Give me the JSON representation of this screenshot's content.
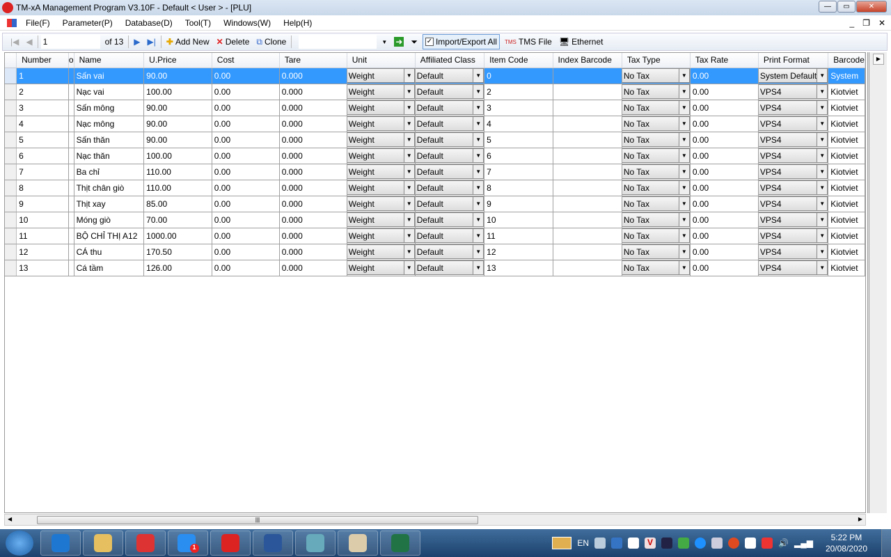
{
  "window": {
    "title": "TM-xA Management Program V3.10F - Default < User >  - [PLU]"
  },
  "menu": [
    "File(F)",
    "Parameter(P)",
    "Database(D)",
    "Tool(T)",
    "Windows(W)",
    "Help(H)"
  ],
  "toolbar": {
    "position": "1",
    "of": "of 13",
    "add_new": "Add New",
    "delete": "Delete",
    "clone": "Clone",
    "import_export": "Import/Export All",
    "tms_file": "TMS File",
    "ethernet": "Ethernet"
  },
  "columns": [
    "Number",
    "o",
    "Name",
    "U.Price",
    "Cost",
    "Tare",
    "Unit",
    "Affiliated Class",
    "Item Code",
    "Index Barcode",
    "Tax Type",
    "Tax Rate",
    "Print Format",
    "Barcode"
  ],
  "rows": [
    [
      "1",
      "Sấn vai",
      "90.00",
      "0.00",
      "0.000",
      "Weight",
      "Default",
      "0",
      "",
      "No Tax",
      "0.00",
      "System Default",
      "System"
    ],
    [
      "2",
      "Nạc vai",
      "100.00",
      "0.00",
      "0.000",
      "Weight",
      "Default",
      "2",
      "",
      "No Tax",
      "0.00",
      "VPS4",
      "Kiotviet"
    ],
    [
      "3",
      "Sấn mông",
      "90.00",
      "0.00",
      "0.000",
      "Weight",
      "Default",
      "3",
      "",
      "No Tax",
      "0.00",
      "VPS4",
      "Kiotviet"
    ],
    [
      "4",
      "Nạc mông",
      "90.00",
      "0.00",
      "0.000",
      "Weight",
      "Default",
      "4",
      "",
      "No Tax",
      "0.00",
      "VPS4",
      "Kiotviet"
    ],
    [
      "5",
      "Sấn thăn",
      "90.00",
      "0.00",
      "0.000",
      "Weight",
      "Default",
      "5",
      "",
      "No Tax",
      "0.00",
      "VPS4",
      "Kiotviet"
    ],
    [
      "6",
      "Nạc thăn",
      "100.00",
      "0.00",
      "0.000",
      "Weight",
      "Default",
      "6",
      "",
      "No Tax",
      "0.00",
      "VPS4",
      "Kiotviet"
    ],
    [
      "7",
      "Ba chỉ",
      "110.00",
      "0.00",
      "0.000",
      "Weight",
      "Default",
      "7",
      "",
      "No Tax",
      "0.00",
      "VPS4",
      "Kiotviet"
    ],
    [
      "8",
      "Thịt chân giò",
      "110.00",
      "0.00",
      "0.000",
      "Weight",
      "Default",
      "8",
      "",
      "No Tax",
      "0.00",
      "VPS4",
      "Kiotviet"
    ],
    [
      "9",
      "Thịt xay",
      "85.00",
      "0.00",
      "0.000",
      "Weight",
      "Default",
      "9",
      "",
      "No Tax",
      "0.00",
      "VPS4",
      "Kiotviet"
    ],
    [
      "10",
      "Móng giò",
      "70.00",
      "0.00",
      "0.000",
      "Weight",
      "Default",
      "10",
      "",
      "No Tax",
      "0.00",
      "VPS4",
      "Kiotviet"
    ],
    [
      "11",
      "BỘ CHỈ THỊ A12",
      "1000.00",
      "0.00",
      "0.000",
      "Weight",
      "Default",
      "11",
      "",
      "No Tax",
      "0.00",
      "VPS4",
      "Kiotviet"
    ],
    [
      "12",
      "CÁ thu",
      "170.50",
      "0.00",
      "0.000",
      "Weight",
      "Default",
      "12",
      "",
      "No Tax",
      "0.00",
      "VPS4",
      "Kiotviet"
    ],
    [
      "13",
      "Cá tầm",
      "126.00",
      "0.00",
      "0.000",
      "Weight",
      "Default",
      "13",
      "",
      "No Tax",
      "0.00",
      "VPS4",
      "Kiotviet"
    ]
  ],
  "taskbar": {
    "apps": [
      "IE",
      "Explorer",
      "Chrome",
      "Zalo",
      "TM-xA",
      "Word",
      "Photos",
      "Paint",
      "Excel"
    ],
    "zalo_badge": "1",
    "lang": "EN",
    "time": "5:22 PM",
    "date": "20/08/2020"
  }
}
